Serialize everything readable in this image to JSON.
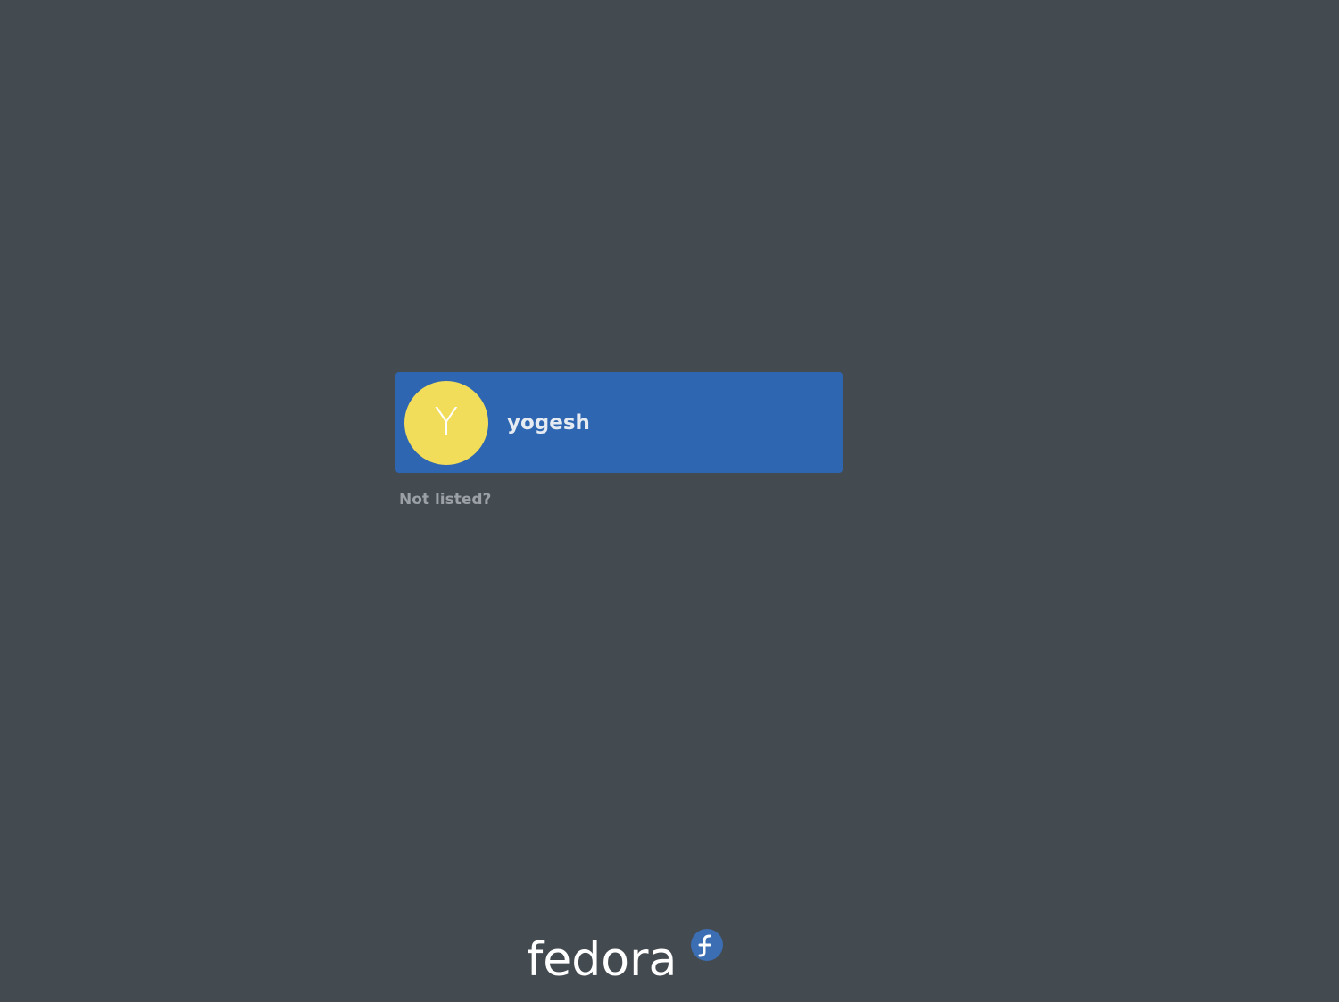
{
  "colors": {
    "background": "#434a50",
    "selection": "#2f66b1",
    "avatar_bg": "#f2dd5a",
    "logo_mark": "#3c6eb4"
  },
  "users": [
    {
      "initial": "Y",
      "name": "yogesh"
    }
  ],
  "not_listed_label": "Not listed?",
  "logo": {
    "text": "fedora",
    "icon": "fedora-infinity-icon"
  }
}
